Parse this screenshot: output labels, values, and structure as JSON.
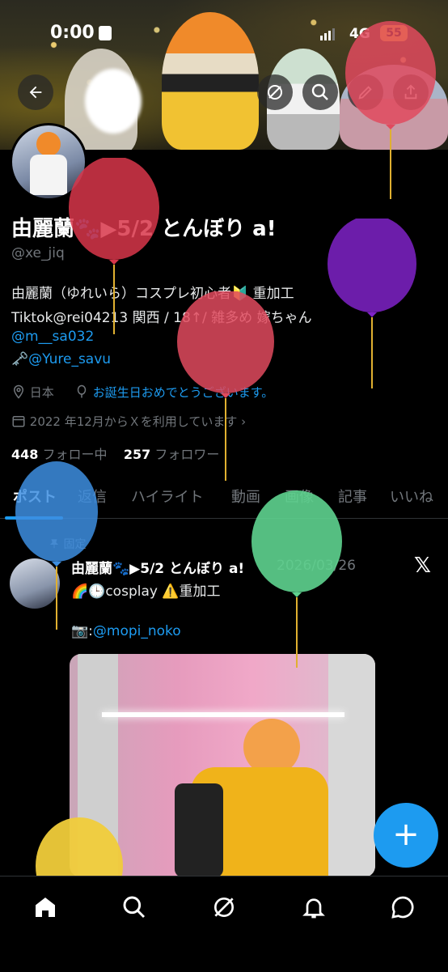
{
  "status": {
    "time": "0:00",
    "network": "4G",
    "battery": "55"
  },
  "profile": {
    "name": "由麗蘭🐾▶5/2 とんぼり a!",
    "handle": "@xe_jiq",
    "bio_line1": "由麗蘭（ゆれいら）コスプレ初心者🔰 重加工",
    "bio_line2": "Tiktok@rei04213 関西 / 18↑/ 雑多め 嫁ちゃん",
    "bio_link1": "@m__sa032",
    "bio_key": "🗝️",
    "bio_link2": "@Yure_savu",
    "location": "日本",
    "birthday": "お誕生日おめでとうございます。",
    "joined": "2022 年12月からＸを利用しています",
    "following_count": "448",
    "following_label": "フォロー中",
    "followers_count": "257",
    "followers_label": "フォロワー"
  },
  "tabs": [
    "ポスト",
    "返信",
    "ハイライト",
    "動画",
    "画像",
    "記事",
    "いいね"
  ],
  "tweet": {
    "pinned_label": "固定",
    "author": "由麗蘭🐾▶5/2 とんぼり a!",
    "date": "2026/03/26",
    "text": "🌈🕒cosplay ⚠️重加工",
    "credit_prefix": "📷:",
    "credit_link": "@mopi_noko"
  },
  "fab_label": "+",
  "colors": {
    "accent": "#1d9bf0",
    "background": "#000000",
    "muted": "#71767b"
  },
  "icons": [
    "back-arrow-icon",
    "grok-icon",
    "search-icon",
    "edit-icon",
    "share-icon",
    "location-icon",
    "balloon-icon",
    "calendar-icon",
    "pin-icon",
    "x-logo-icon",
    "home-icon",
    "search-nav-icon",
    "grok-nav-icon",
    "bell-icon",
    "messages-icon"
  ]
}
